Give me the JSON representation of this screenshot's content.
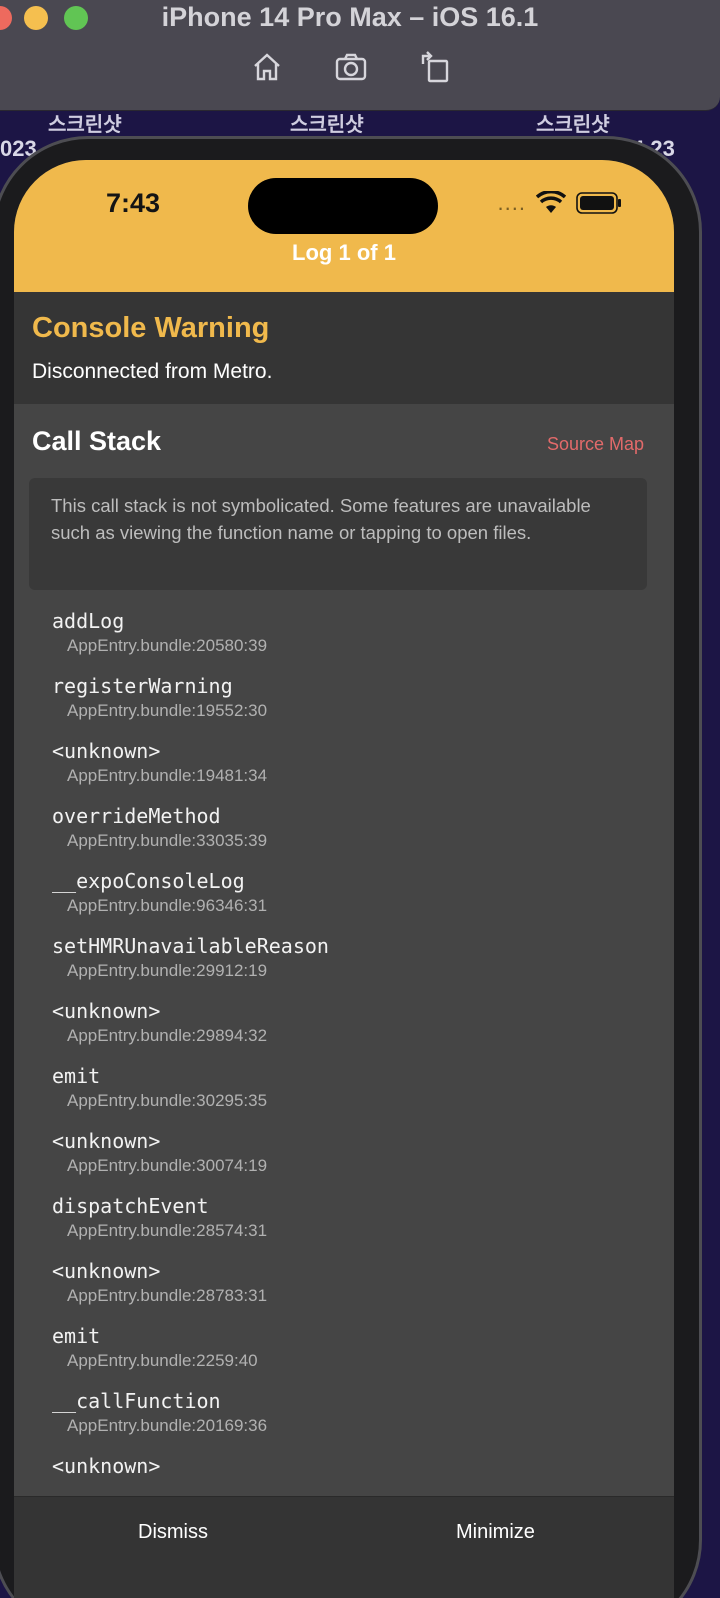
{
  "window": {
    "title": "iPhone 14 Pro Max – iOS 16.1",
    "toolbar_icons": [
      "home-icon",
      "camera-icon",
      "rotate-icon"
    ]
  },
  "desktop": {
    "labels": [
      "스크린샷",
      "스크린샷",
      "스크린샷"
    ],
    "date_left": "023",
    "date_right": "4.23"
  },
  "status_bar": {
    "time": "7:43",
    "signal": "....",
    "icons": [
      "wifi-icon",
      "battery-icon"
    ]
  },
  "header": {
    "log_count": "Log 1 of 1",
    "accent": "#f0b94c"
  },
  "warning": {
    "title": "Console Warning",
    "message": "Disconnected from Metro."
  },
  "call_stack": {
    "title": "Call Stack",
    "source_map": "Source Map",
    "notice": "This call stack is not symbolicated. Some features are unavailable such as viewing the function name or tapping to open files.",
    "frames": [
      {
        "name": "addLog",
        "loc": "AppEntry.bundle:20580:39"
      },
      {
        "name": "registerWarning",
        "loc": "AppEntry.bundle:19552:30"
      },
      {
        "name": "<unknown>",
        "loc": "AppEntry.bundle:19481:34"
      },
      {
        "name": "overrideMethod",
        "loc": "AppEntry.bundle:33035:39"
      },
      {
        "name": "__expoConsoleLog",
        "loc": "AppEntry.bundle:96346:31"
      },
      {
        "name": "setHMRUnavailableReason",
        "loc": "AppEntry.bundle:29912:19"
      },
      {
        "name": "<unknown>",
        "loc": "AppEntry.bundle:29894:32"
      },
      {
        "name": "emit",
        "loc": "AppEntry.bundle:30295:35"
      },
      {
        "name": "<unknown>",
        "loc": "AppEntry.bundle:30074:19"
      },
      {
        "name": "dispatchEvent",
        "loc": "AppEntry.bundle:28574:31"
      },
      {
        "name": "<unknown>",
        "loc": "AppEntry.bundle:28783:31"
      },
      {
        "name": "emit",
        "loc": "AppEntry.bundle:2259:40"
      },
      {
        "name": "__callFunction",
        "loc": "AppEntry.bundle:20169:36"
      },
      {
        "name": "<unknown>",
        "loc": ""
      }
    ]
  },
  "footer": {
    "dismiss": "Dismiss",
    "minimize": "Minimize"
  }
}
